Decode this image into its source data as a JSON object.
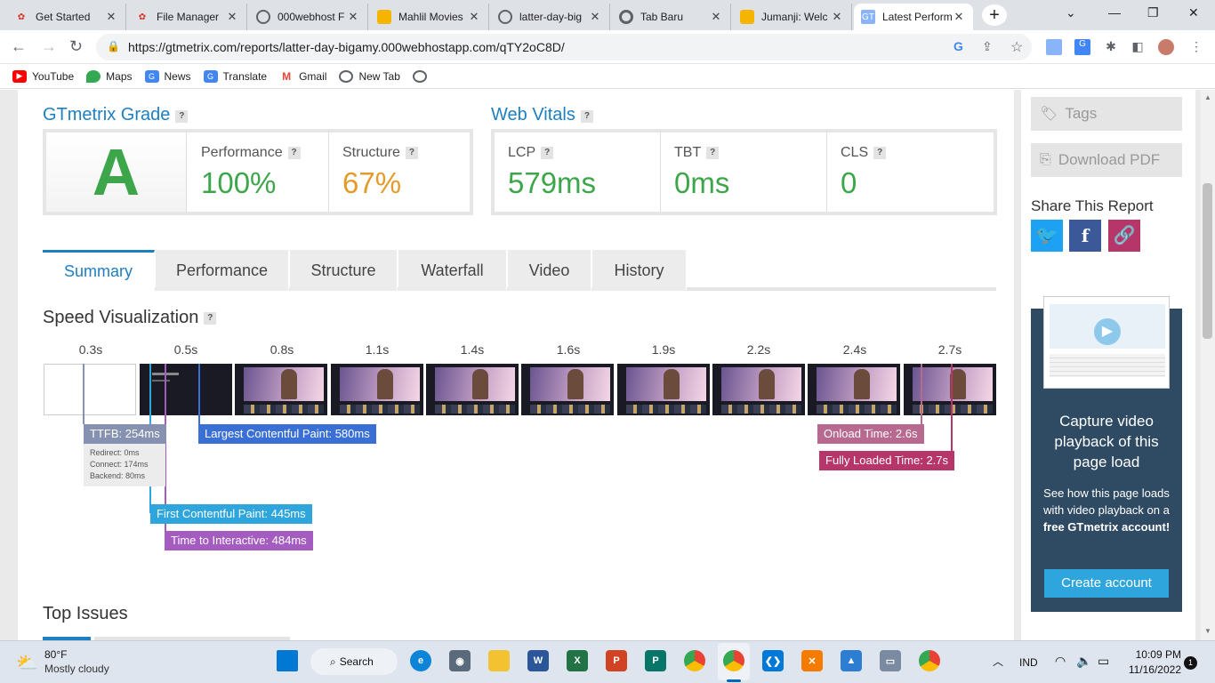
{
  "browser": {
    "tabs": [
      {
        "title": "Get Started",
        "fav_color": "#d93025",
        "active": false
      },
      {
        "title": "File Manager",
        "fav_color": "#d93025",
        "active": false
      },
      {
        "title": "000webhost F",
        "fav_color": "#5f6368",
        "active": false
      },
      {
        "title": "Mahlil Movies",
        "fav_color": "#f4b400",
        "active": false
      },
      {
        "title": "latter-day-big",
        "fav_color": "#5f6368",
        "active": false
      },
      {
        "title": "Tab Baru",
        "fav_color": "#5f6368",
        "active": false
      },
      {
        "title": "Jumanji: Welc",
        "fav_color": "#f4b400",
        "active": false
      },
      {
        "title": "Latest Perform",
        "fav_color": "#8ab4f8",
        "active": true
      }
    ],
    "url": "https://gtmetrix.com/reports/latter-day-bigamy.000webhostapp.com/qTY2oC8D/",
    "bookmarks": [
      "YouTube",
      "Maps",
      "News",
      "Translate",
      "Gmail",
      "New Tab"
    ]
  },
  "grade": {
    "title": "GTmetrix Grade",
    "help": "?",
    "letter": "A",
    "performance_label": "Performance",
    "performance_value": "100%",
    "structure_label": "Structure",
    "structure_value": "67%"
  },
  "vitals": {
    "title": "Web Vitals",
    "help": "?",
    "lcp_label": "LCP",
    "lcp_value": "579ms",
    "tbt_label": "TBT",
    "tbt_value": "0ms",
    "cls_label": "CLS",
    "cls_value": "0"
  },
  "report_tabs": [
    "Summary",
    "Performance",
    "Structure",
    "Waterfall",
    "Video",
    "History"
  ],
  "speed": {
    "title": "Speed Visualization",
    "times": [
      "0.3s",
      "0.5s",
      "0.8s",
      "1.1s",
      "1.4s",
      "1.6s",
      "1.9s",
      "2.2s",
      "2.4s",
      "2.7s"
    ],
    "ttfb": "TTFB: 254ms",
    "ttfb_details": [
      "Redirect: 0ms",
      "Connect: 174ms",
      "Backend: 80ms"
    ],
    "lcp": "Largest Contentful Paint: 580ms",
    "fcp": "First Contentful Paint: 445ms",
    "tti": "Time to Interactive: 484ms",
    "onload": "Onload Time: 2.6s",
    "fully_loaded": "Fully Loaded Time: 2.7s"
  },
  "top_issues": {
    "title": "Top Issues"
  },
  "sidebar": {
    "tags": "Tags",
    "download_pdf": "Download PDF",
    "share_title": "Share This Report",
    "promo_title": "Capture video playback of this page load",
    "promo_text_1": "See how this page loads with video playback on a ",
    "promo_text_bold": "free GTmetrix account!",
    "create_account": "Create account"
  },
  "taskbar": {
    "temp": "80°F",
    "weather": "Mostly cloudy",
    "search": "Search",
    "lang": "IND",
    "time": "10:09 PM",
    "date": "11/16/2022",
    "notif": "1"
  },
  "colors": {
    "grade_green": "#3ea64a",
    "orange": "#e39b2a",
    "gt_blue": "#1e7fc1",
    "ttfb": "#8691b1",
    "lcp": "#3a6fd6",
    "fcp": "#2ea6dd",
    "tti": "#a55cc1",
    "onload": "#b8698f",
    "fully": "#b6366a"
  }
}
